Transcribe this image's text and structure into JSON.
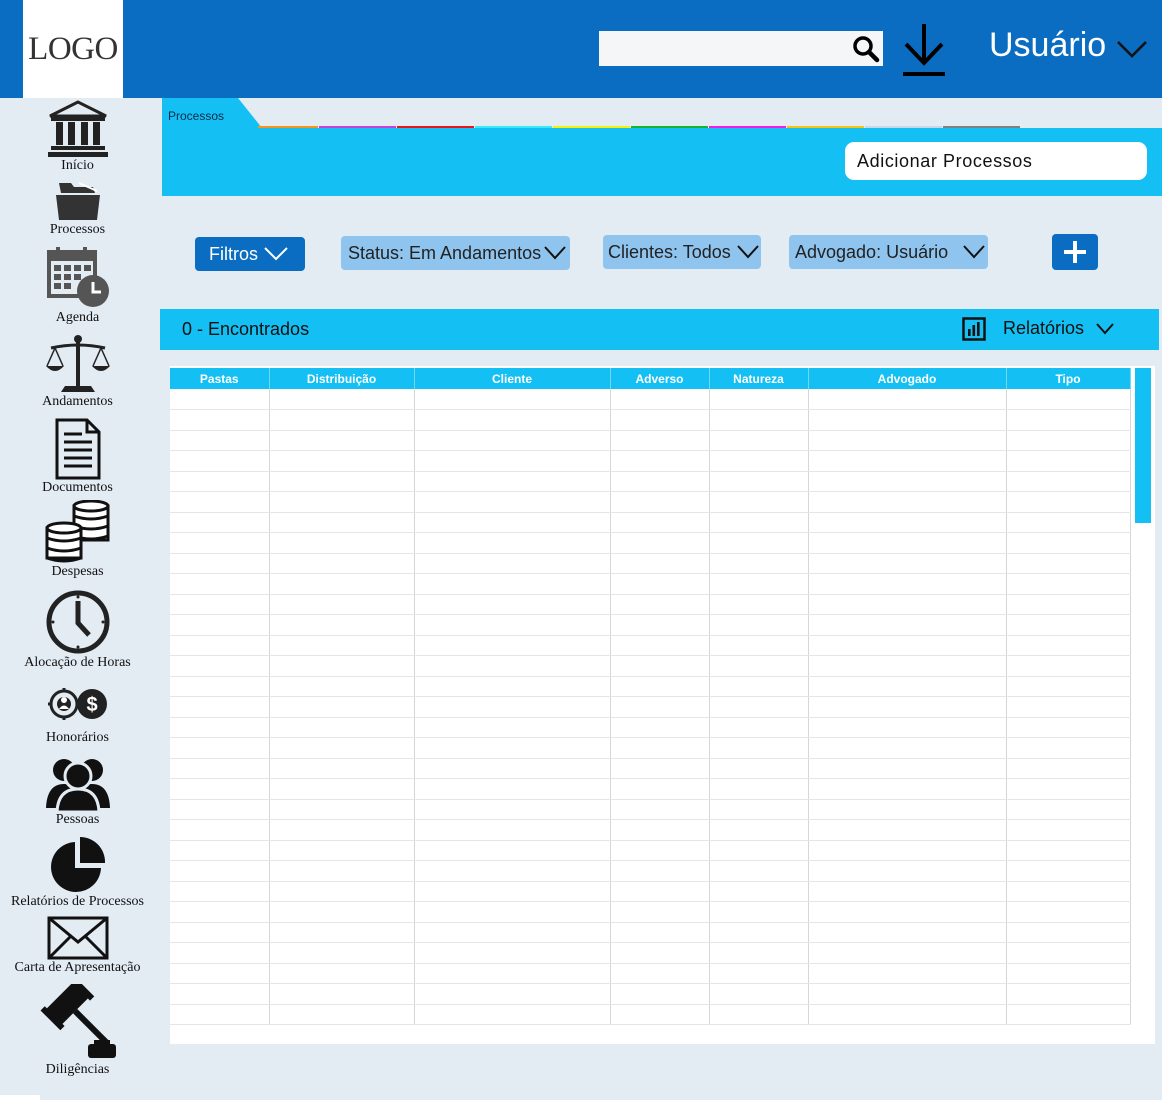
{
  "header": {
    "logo": "LOGO",
    "search": {
      "value": "",
      "placeholder": ""
    },
    "user_label": "Usuário",
    "icons": {
      "search": "search-icon",
      "download": "download-icon",
      "user_menu": "chevron-down-icon"
    }
  },
  "sidebar": {
    "items": [
      {
        "label": "Início",
        "icon": "bank-icon"
      },
      {
        "label": "Processos",
        "icon": "folder-icon"
      },
      {
        "label": "Agenda",
        "icon": "calendar-clock-icon"
      },
      {
        "label": "Andamentos",
        "icon": "scales-icon"
      },
      {
        "label": "Documentos",
        "icon": "document-icon"
      },
      {
        "label": "Despesas",
        "icon": "coins-icon"
      },
      {
        "label": "Alocação de Horas",
        "icon": "clock-icon"
      },
      {
        "label": "Honorários",
        "icon": "fees-icon"
      },
      {
        "label": "Pessoas",
        "icon": "people-icon"
      },
      {
        "label": "Relatórios de Processos",
        "icon": "pie-chart-icon"
      },
      {
        "label": "Carta de Apresentação",
        "icon": "envelope-icon"
      },
      {
        "label": "Diligências",
        "icon": "gavel-icon"
      }
    ]
  },
  "tabs": {
    "active_label": "Processos",
    "strip_colors": [
      "#f7941d",
      "#c443d6",
      "#e8161b",
      "#3ee8f8",
      "#f2f20a",
      "#14b52e",
      "#f01fe8",
      "#f5c216",
      "#c8d8e8",
      "#808080"
    ]
  },
  "panel": {
    "add_button": "Adicionar Processos"
  },
  "filters": {
    "filtros": "Filtros",
    "status": "Status: Em Andamentos",
    "clientes": "Clientes: Todos",
    "advogado": "Advogado: Usuário"
  },
  "results": {
    "count": "0 - Encontrados",
    "reports": "Relatórios"
  },
  "table": {
    "columns": [
      "Pastas",
      "Distribuição",
      "Cliente",
      "Adverso",
      "Natureza",
      "Advogado",
      "Tipo"
    ]
  },
  "colors": {
    "primary": "#0b6dc2",
    "accent": "#14c0f3",
    "pill": "#8fc4ef",
    "background": "#e3ebf3"
  }
}
